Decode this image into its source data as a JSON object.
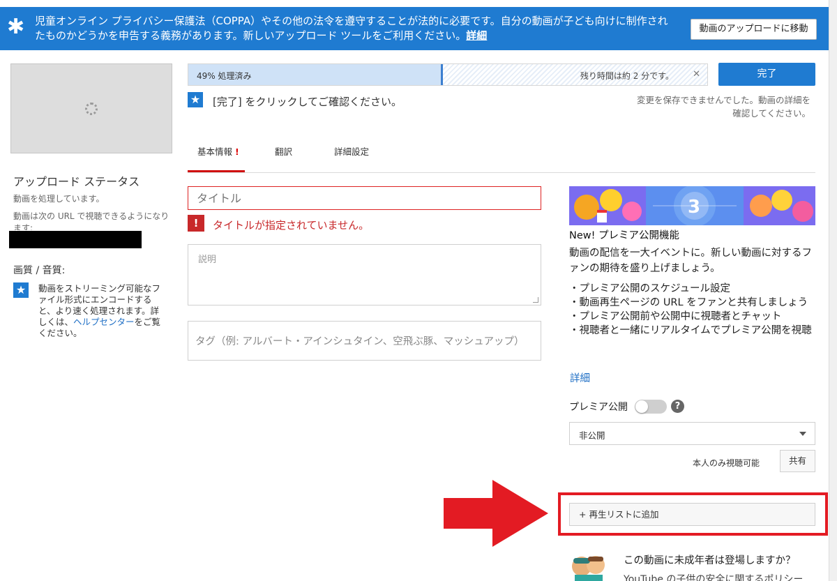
{
  "banner": {
    "text": "児童オンライン プライバシー保護法（COPPA）やその他の法令を遵守することが法的に必要です。自分の動画が子ども向けに制作されたものかどうかを申告する義務があります。新しいアップロード ツールをご利用ください。",
    "link": "詳細",
    "move_button": "動画のアップロードに移動",
    "color": "#1f7bd1"
  },
  "left": {
    "upload_status_title": "アップロード ステータス",
    "processing": "動画を処理しています。",
    "url_note": "動画は次の URL で視聴できるようになります:",
    "quality_label": "画質 / 音質:",
    "quality_text": "動画をストリーミング可能なファイル形式にエンコードすると、より速く処理されます。詳しくは、",
    "help_link": "ヘルプセンター",
    "quality_suffix": "をご覧ください。"
  },
  "progress": {
    "percent": 49,
    "label": "49% 処理済み",
    "remaining": "残り時間は約 2 分です。",
    "done_button": "完了",
    "confirm_text": "[完了] をクリックしてご確認ください。",
    "save_error": "変更を保存できませんでした。動画の詳細を確認してください。"
  },
  "tabs": {
    "basic": "基本情報",
    "translate": "翻訳",
    "advanced": "詳細設定"
  },
  "form": {
    "title_placeholder": "タイトル",
    "title_error": "タイトルが指定されていません。",
    "description_placeholder": "説明",
    "tags_placeholder": "タグ（例: アルバート・アインシュタイン、空飛ぶ豚、マッシュアップ）"
  },
  "premiere": {
    "title": "New! プレミア公開機能",
    "body": "動画の配信を一大イベントに。新しい動画に対するファンの期待を盛り上げましょう。",
    "items": [
      "・プレミア公開のスケジュール設定",
      "・動画再生ページの URL をファンと共有しましょう",
      "・プレミア公開前や公開中に視聴者とチャット",
      "・視聴者と一緒にリアルタイムでプレミア公開を視聴"
    ],
    "more": "詳細",
    "toggle_label": "プレミア公開",
    "toggle_on": false
  },
  "privacy": {
    "selected": "非公開",
    "note": "本人のみ視聴可能",
    "share_button": "共有"
  },
  "playlist": {
    "add_button": "+ 再生リストに追加"
  },
  "kids": {
    "question": "この動画に未成年者は登場しますか？",
    "sub": "YouTube の子供の安全に関するポリシー"
  },
  "colors": {
    "accent": "#1f7bd1",
    "error": "#c8282a",
    "annotation": "#e31b23"
  }
}
